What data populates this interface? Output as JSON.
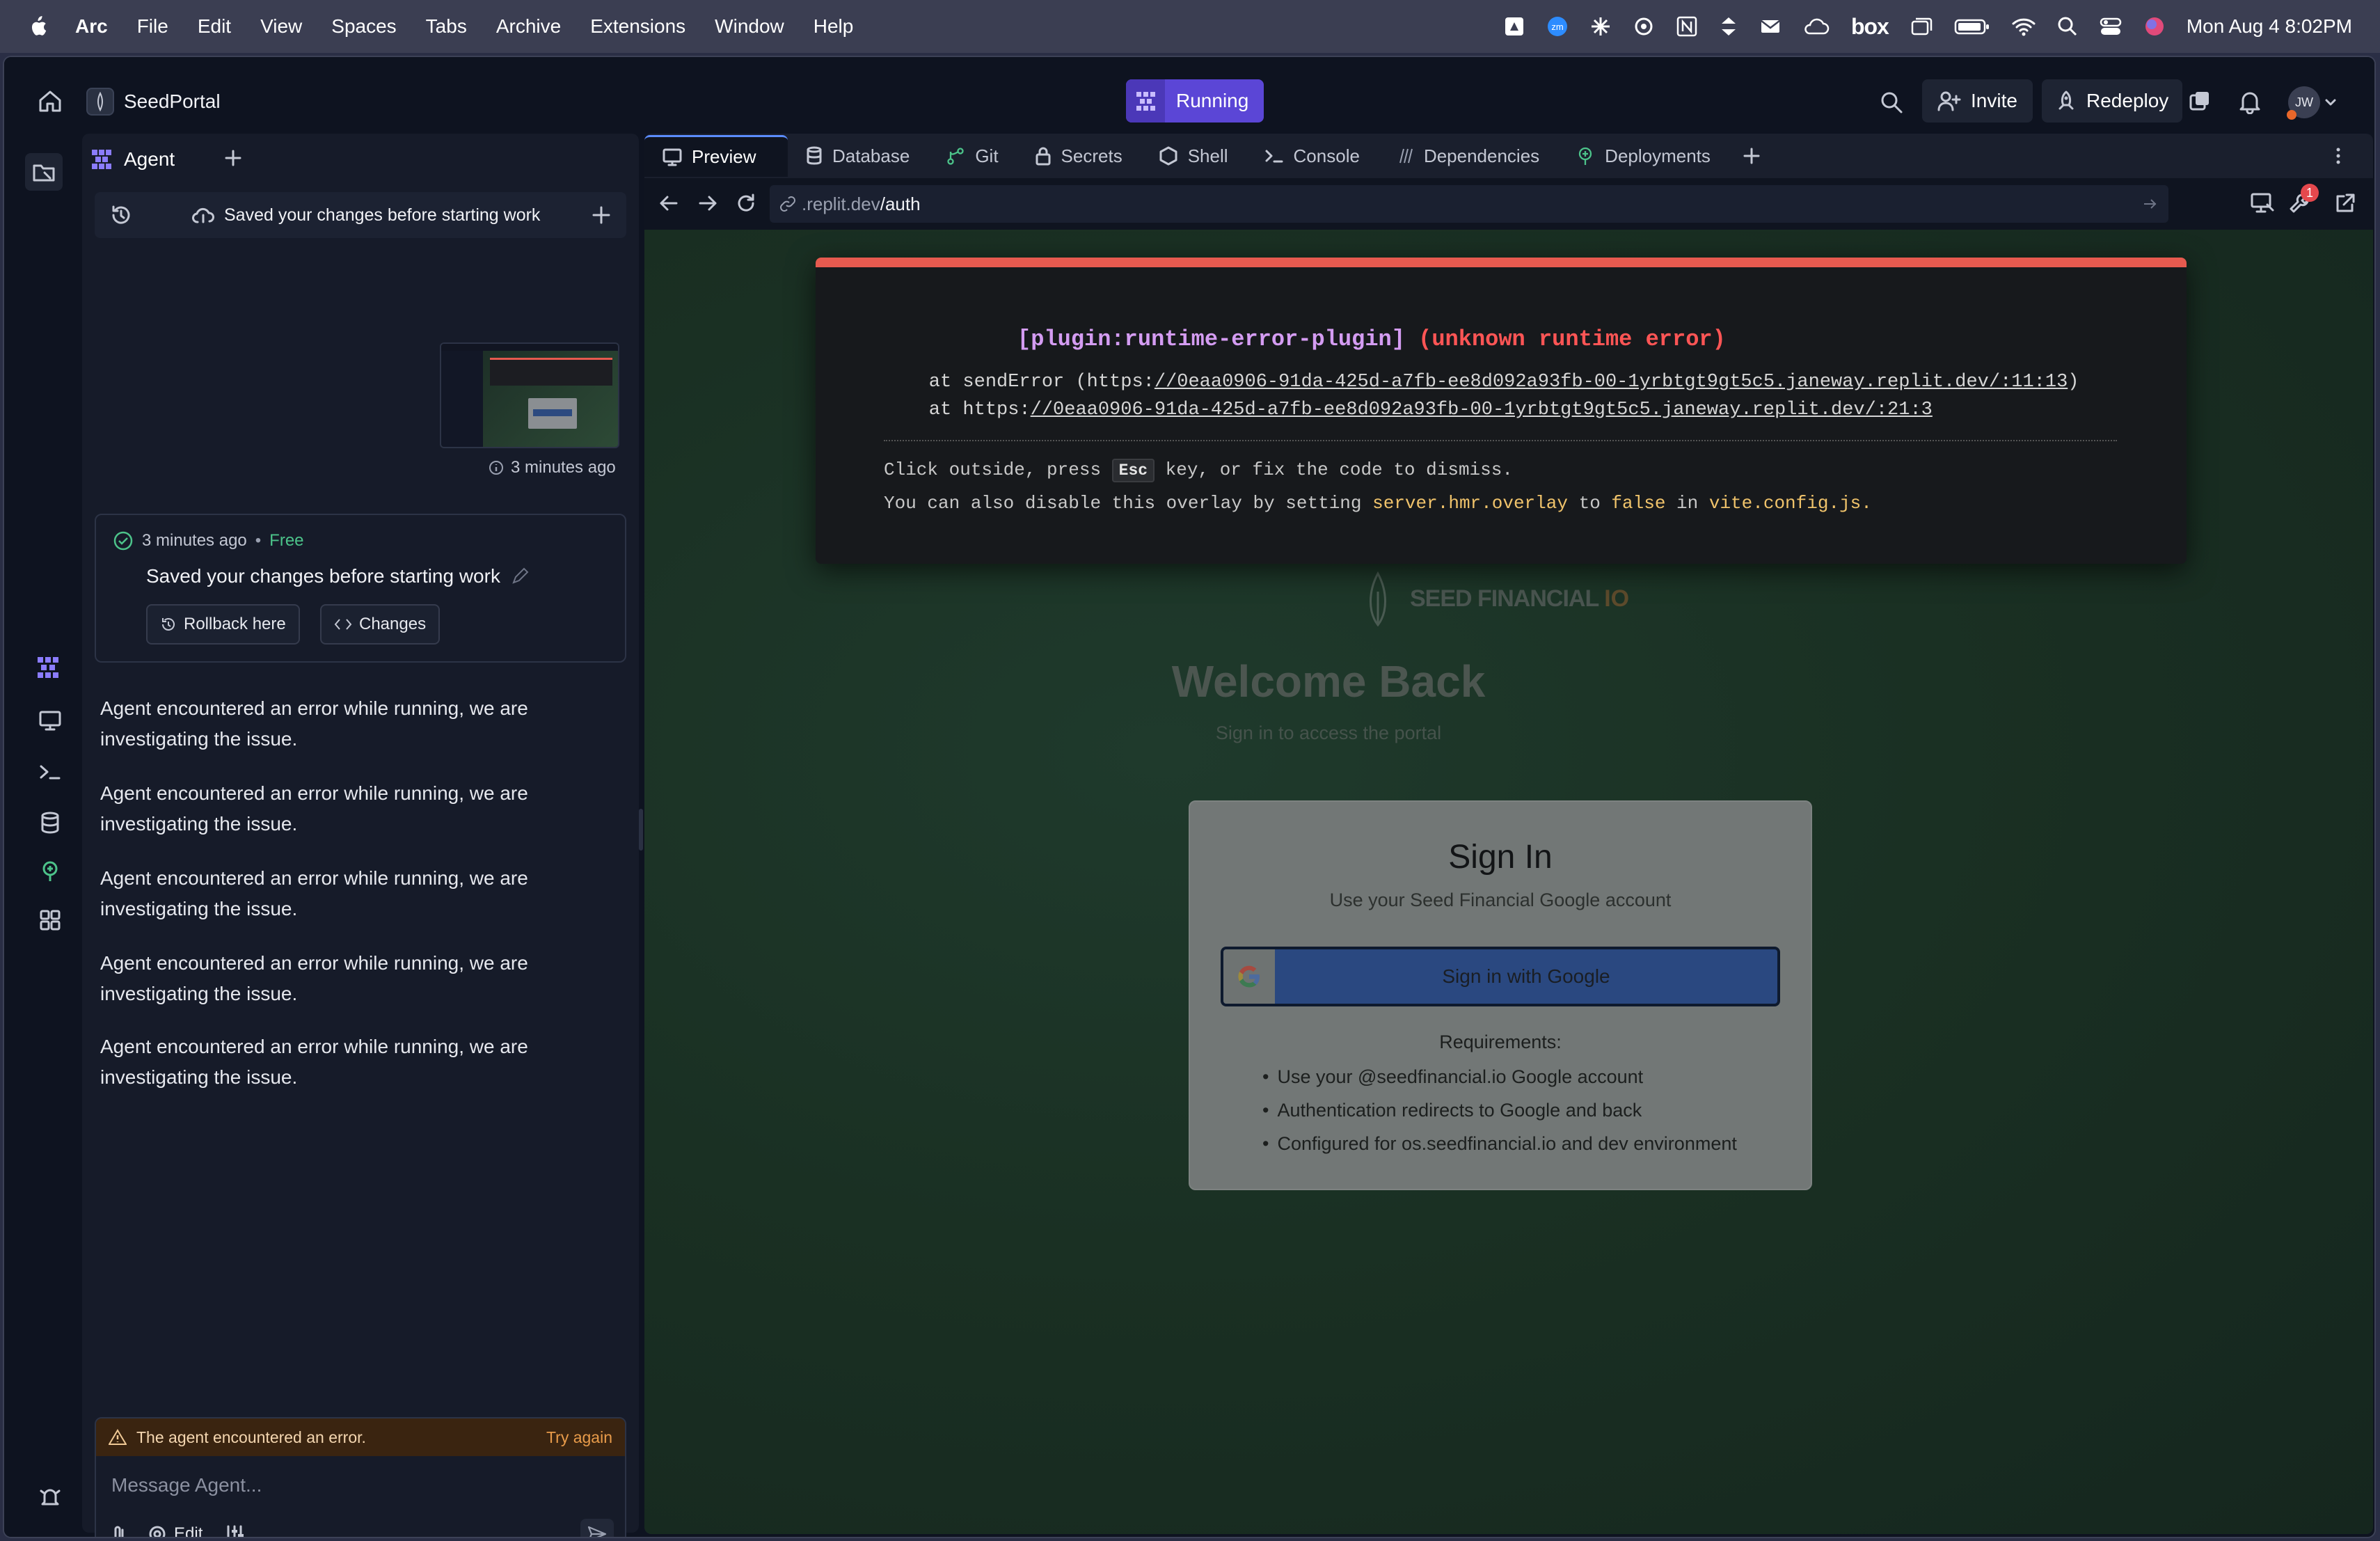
{
  "menubar": {
    "app": "Arc",
    "items": [
      "File",
      "Edit",
      "View",
      "Spaces",
      "Tabs",
      "Archive",
      "Extensions",
      "Window",
      "Help"
    ],
    "datetime": "Mon Aug 4  8:02PM"
  },
  "topbar": {
    "project_name": "SeedPortal",
    "run_status": "Running",
    "invite_label": "Invite",
    "redeploy_label": "Redeploy",
    "avatar_initials": "JW"
  },
  "agent": {
    "tab_label": "Agent",
    "checkpoint_bar_text": "Saved your changes before starting work",
    "screenshot_time": "3 minutes ago",
    "checkpoint": {
      "time": "3 minutes ago",
      "price": "Free",
      "title": "Saved your changes before starting work",
      "rollback_label": "Rollback here",
      "changes_label": "Changes"
    },
    "messages": [
      "Agent encountered an error while running, we are investigating the issue.",
      "Agent encountered an error while running, we are investigating the issue.",
      "Agent encountered an error while running, we are investigating the issue.",
      "Agent encountered an error while running, we are investigating the issue.",
      "Agent encountered an error while running, we are investigating the issue."
    ],
    "error_banner": "The agent encountered an error.",
    "try_again": "Try again",
    "input_placeholder": "Message Agent...",
    "edit_label": "Edit"
  },
  "tabs": [
    "Preview",
    "Database",
    "Git",
    "Secrets",
    "Shell",
    "Console",
    "Dependencies",
    "Deployments"
  ],
  "address": {
    "prefix": ".replit.dev",
    "path": "/auth"
  },
  "notif_count": "1",
  "error_overlay": {
    "plugin": "[plugin:runtime-error-plugin]",
    "message": "(unknown runtime error)",
    "stack1_pre": "    at sendError (https:",
    "stack1_link": "//0eaa0906-91da-425d-a7fb-ee8d092a93fb-00-1yrbtgt9gt5c5.janeway.replit.dev/:11:13",
    "stack1_post": ")",
    "stack2_pre": "    at https:",
    "stack2_link": "//0eaa0906-91da-425d-a7fb-ee8d092a93fb-00-1yrbtgt9gt5c5.janeway.replit.dev/:21:3",
    "tip1_pre": "Click outside, press ",
    "tip1_key": "Esc",
    "tip1_post": " key, or fix the code to dismiss.",
    "tip2_pre": "You can also disable this overlay by setting ",
    "tip2_code": "server.hmr.overlay",
    "tip2_mid": " to ",
    "tip2_false": "false",
    "tip2_in": " in ",
    "tip2_file": "vite.config.js",
    "tip2_end": "."
  },
  "site": {
    "brand": "SEED FINANCIAL",
    "brand_suffix": "IO",
    "welcome": "Welcome Back",
    "subtitle": "Sign in to access the portal",
    "card_title": "Sign In",
    "card_subtitle": "Use your Seed Financial Google account",
    "google_button": "Sign in with Google",
    "requirements_title": "Requirements:",
    "requirements": [
      "Use your @seedfinancial.io Google account",
      "Authentication redirects to Google and back",
      "Configured for os.seedfinancial.io and dev environment"
    ]
  },
  "colors": {
    "accent_purple": "#5b46d6",
    "error_red": "#e65a4f",
    "plugin_purple": "#d49cf2",
    "success_green": "#4cc38a"
  }
}
